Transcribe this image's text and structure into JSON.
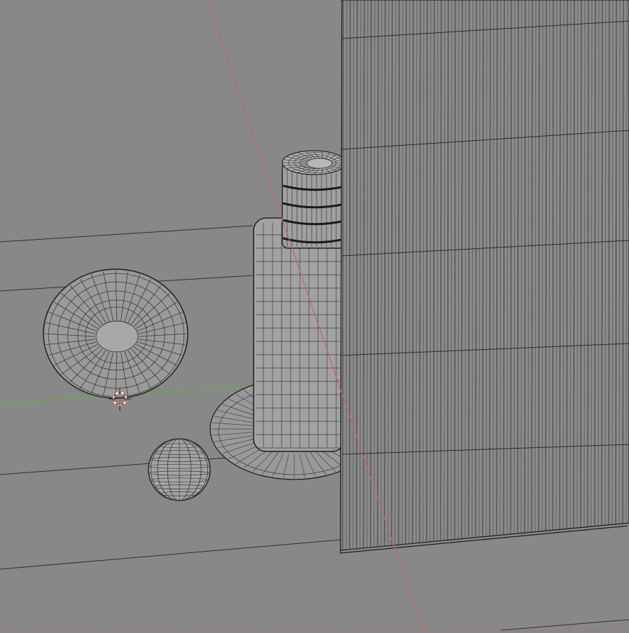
{
  "viewport": {
    "mode": "wireframe-overlay",
    "background_color": "#888888",
    "axes": {
      "x_axis_color": "#c86464",
      "y_axis_color": "#6aa84f"
    },
    "objects": [
      {
        "name": "disc",
        "kind": "flattened-uv-sphere"
      },
      {
        "name": "sphere",
        "kind": "uv-sphere"
      },
      {
        "name": "bottle-body",
        "kind": "rounded-box"
      },
      {
        "name": "bottle-cap",
        "kind": "ribbed-cylinder"
      },
      {
        "name": "base-plate",
        "kind": "disc"
      },
      {
        "name": "curtain",
        "kind": "pleated-cloth"
      }
    ],
    "cursor_icon": "3d-cursor-icon"
  }
}
